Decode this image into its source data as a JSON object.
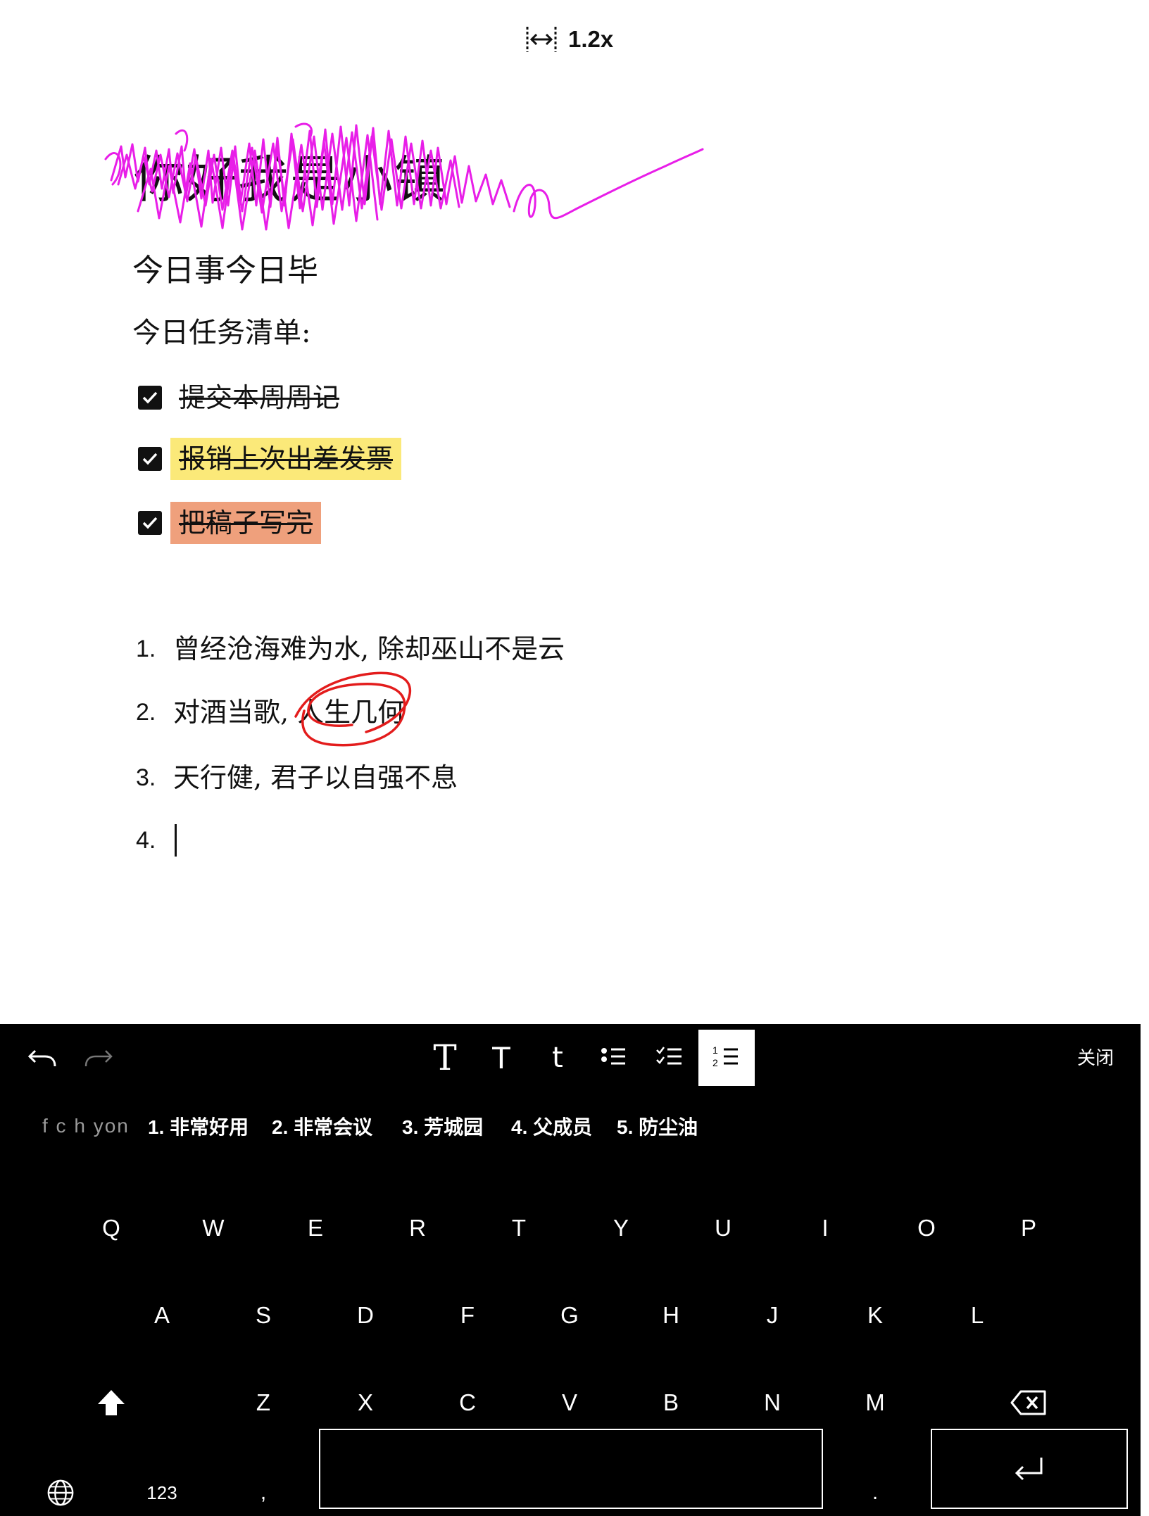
{
  "zoom": {
    "icon": "fit-width-icon",
    "label": "1.2x"
  },
  "document": {
    "title": "你好我是小镇",
    "subtitle": "今日事今日毕",
    "tasks_heading": "今日任务清单:",
    "tasks": [
      {
        "text": "提交本周周记",
        "checked": true,
        "highlight": "none"
      },
      {
        "text": "报销上次出差发票",
        "checked": true,
        "highlight": "#fbe979"
      },
      {
        "text": "把稿子写完",
        "checked": true,
        "highlight": "#efa07c"
      }
    ],
    "numbered": [
      {
        "num": "1.",
        "text": "曾经沧海难为水, 除却巫山不是云"
      },
      {
        "num": "2.",
        "text": "对酒当歌, 人生几何"
      },
      {
        "num": "3.",
        "text": "天行健, 君子以自强不息"
      },
      {
        "num": "4.",
        "text": ""
      }
    ],
    "ink_colors": {
      "scribble": "#e81ee8",
      "circle": "#e31c1c"
    }
  },
  "toolbar": {
    "undo_icon": "undo-icon",
    "redo_icon": "redo-icon",
    "heading1": "T",
    "heading2": "T",
    "body_text": "t",
    "bullet_list_icon": "bullet-list-icon",
    "checklist_icon": "checklist-icon",
    "numbered_list_icon": "numbered-list-icon",
    "active_tool": "numbered-list",
    "close_label": "关闭"
  },
  "candidates": {
    "pinyin": "f c h yon",
    "items": [
      "1. 非常好用",
      "2. 非常会议",
      "3. 芳城园",
      "4. 父成员",
      "5. 防尘油"
    ]
  },
  "keyboard": {
    "row1": [
      "Q",
      "W",
      "E",
      "R",
      "T",
      "Y",
      "U",
      "I",
      "O",
      "P"
    ],
    "row2": [
      "A",
      "S",
      "D",
      "F",
      "G",
      "H",
      "J",
      "K",
      "L"
    ],
    "row3": [
      "Z",
      "X",
      "C",
      "V",
      "B",
      "N",
      "M"
    ],
    "shift_icon": "shift-icon",
    "backspace_icon": "backspace-icon",
    "globe_icon": "globe-icon",
    "numbers_label": "123",
    "comma_label": ",",
    "period_label": ".",
    "space_label": "",
    "enter_icon": "enter-icon"
  }
}
